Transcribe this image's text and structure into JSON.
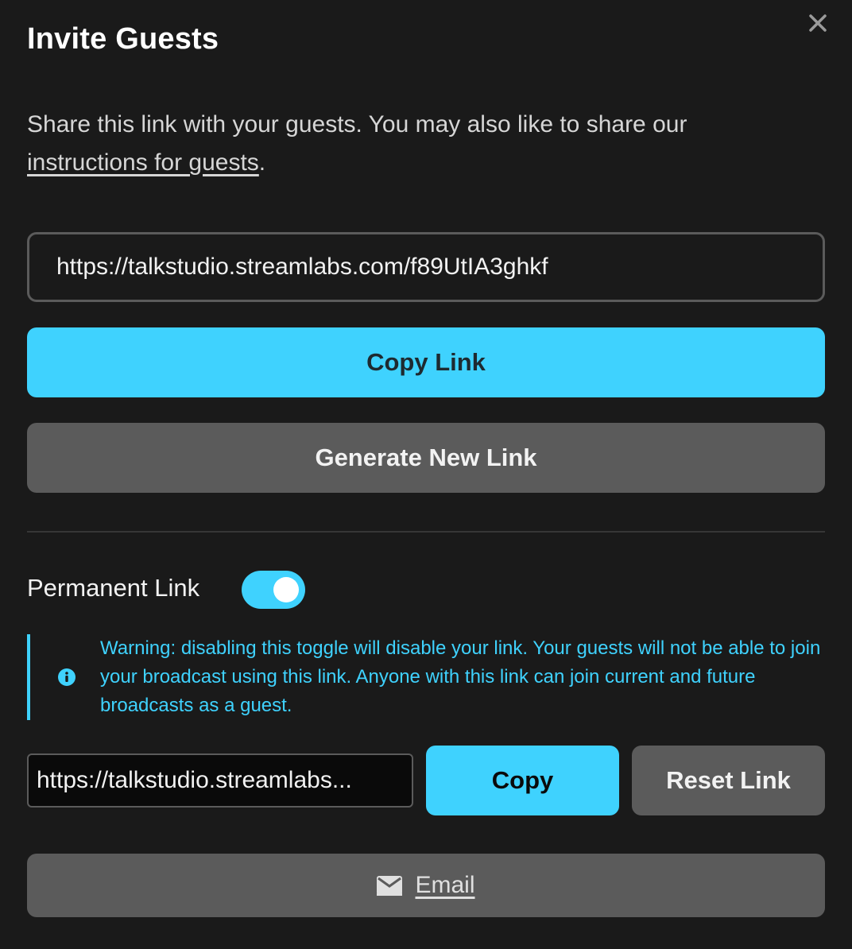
{
  "dialog": {
    "title": "Invite Guests",
    "close_icon": "close-icon"
  },
  "intro": {
    "text": "Share this link with your guests. You may also like to share our ",
    "link_text": "instructions for guests",
    "suffix": "."
  },
  "guest_link": {
    "value": "https://talkstudio.streamlabs.com/f89UtIA3ghkf"
  },
  "actions": {
    "copy_link_label": "Copy Link",
    "generate_label": "Generate New Link"
  },
  "permanent": {
    "label": "Permanent Link",
    "toggle_on": true,
    "warning": "Warning: disabling this toggle will disable your link. Your guests will not be able to join your broadcast using this link. Anyone with this link can join current and future broadcasts as a guest.",
    "warning_icon": "info-icon",
    "link_value": "https://talkstudio.streamlabs...",
    "copy_label": "Copy",
    "reset_label": "Reset Link"
  },
  "email": {
    "label": "Email",
    "icon": "envelope-icon"
  },
  "colors": {
    "accent": "#3fd2fe",
    "background": "#1a1a1a",
    "secondary_button": "#5b5b5b"
  }
}
